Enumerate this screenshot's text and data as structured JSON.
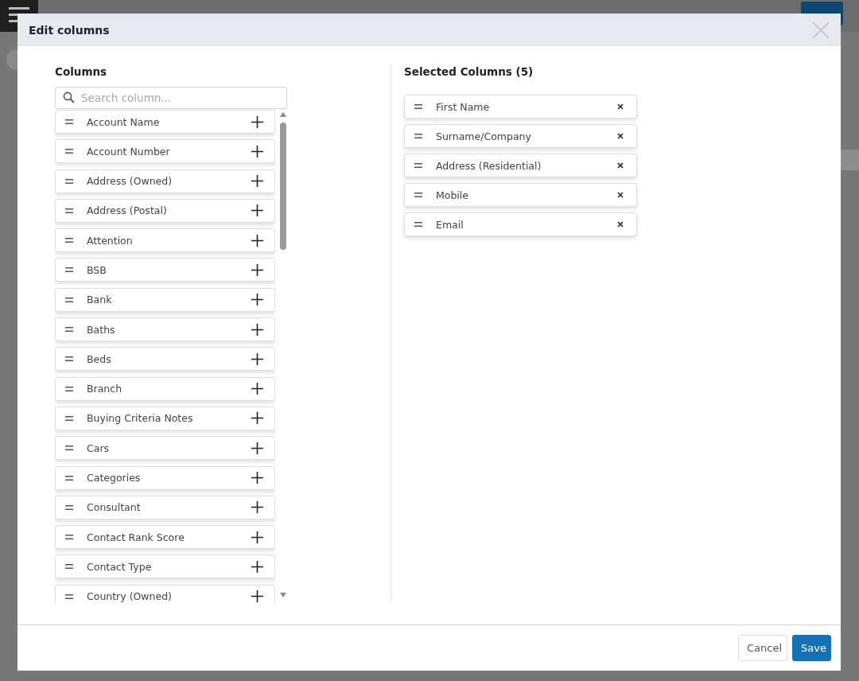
{
  "dialog": {
    "title": "Edit columns",
    "available": {
      "title": "Columns",
      "search": {
        "placeholder": "Search column..."
      },
      "items": [
        {
          "label": "Account Name"
        },
        {
          "label": "Account Number"
        },
        {
          "label": "Address (Owned)"
        },
        {
          "label": "Address (Postal)"
        },
        {
          "label": "Attention"
        },
        {
          "label": "BSB"
        },
        {
          "label": "Bank"
        },
        {
          "label": "Baths"
        },
        {
          "label": "Beds"
        },
        {
          "label": "Branch"
        },
        {
          "label": "Buying Criteria Notes"
        },
        {
          "label": "Cars"
        },
        {
          "label": "Categories"
        },
        {
          "label": "Consultant"
        },
        {
          "label": "Contact Rank Score"
        },
        {
          "label": "Contact Type"
        },
        {
          "label": "Country (Owned)"
        }
      ]
    },
    "selected": {
      "title": "Selected Columns (5)",
      "items": [
        {
          "label": "First Name"
        },
        {
          "label": "Surname/Company"
        },
        {
          "label": "Address (Residential)"
        },
        {
          "label": "Mobile"
        },
        {
          "label": "Email"
        }
      ]
    },
    "buttons": [
      {
        "label": "Cancel",
        "kind": "secondary"
      },
      {
        "label": "Save",
        "kind": "primary"
      }
    ]
  }
}
